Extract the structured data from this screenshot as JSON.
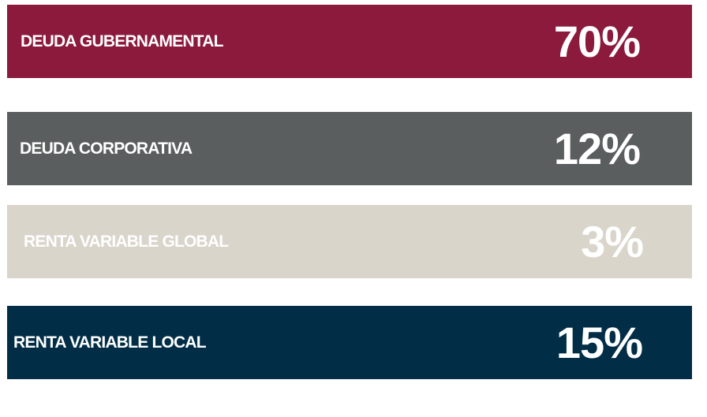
{
  "allocations": [
    {
      "label": "DEUDA GUBERNAMENTAL",
      "value": "70%",
      "color": "#8b1a3d"
    },
    {
      "label": "DEUDA CORPORATIVA",
      "value": "12%",
      "color": "#5b5e5f"
    },
    {
      "label": "RENTA VARIABLE GLOBAL",
      "value": "3%",
      "color": "#d9d5cb"
    },
    {
      "label": "RENTA VARIABLE LOCAL",
      "value": "15%",
      "color": "#012e46"
    }
  ]
}
